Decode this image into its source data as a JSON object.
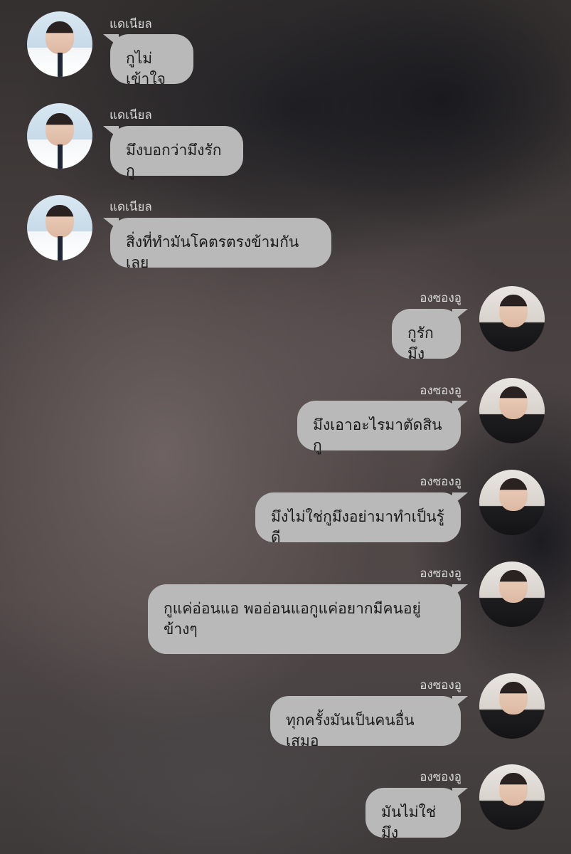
{
  "messages": [
    {
      "sender": "แดเนียล",
      "side": "left",
      "text": "กูไม่เข้าใจ"
    },
    {
      "sender": "แดเนียล",
      "side": "left",
      "text": "มึงบอกว่ามึงรักกู"
    },
    {
      "sender": "แดเนียล",
      "side": "left",
      "text": "สิ่งที่ทำมันโคตรตรงข้ามกันเลย"
    },
    {
      "sender": "องซองอู",
      "side": "right",
      "text": "กูรักมึง"
    },
    {
      "sender": "องซองอู",
      "side": "right",
      "text": "มึงเอาอะไรมาตัดสินกู"
    },
    {
      "sender": "องซองอู",
      "side": "right",
      "text": "มึงไม่ใช่กูมึงอย่ามาทำเป็นรู้ดี"
    },
    {
      "sender": "องซองอู",
      "side": "right",
      "text": "กูแค่อ่อนแอ พออ่อนแอกูแค่อยากมีคนอยู่ข้างๆ"
    },
    {
      "sender": "องซองอู",
      "side": "right",
      "text": "ทุกครั้งมันเป็นคนอื่นเสมอ"
    },
    {
      "sender": "องซองอู",
      "side": "right",
      "text": "มันไม่ใช่มึง"
    }
  ],
  "colors": {
    "bubble": "#b9b9b9",
    "name": "#d8d8d8",
    "text": "#1a1a1a"
  },
  "icons": {
    "left_avatar": "avatar-photo-white-shirt",
    "right_avatar": "avatar-photo-black-shirt"
  }
}
